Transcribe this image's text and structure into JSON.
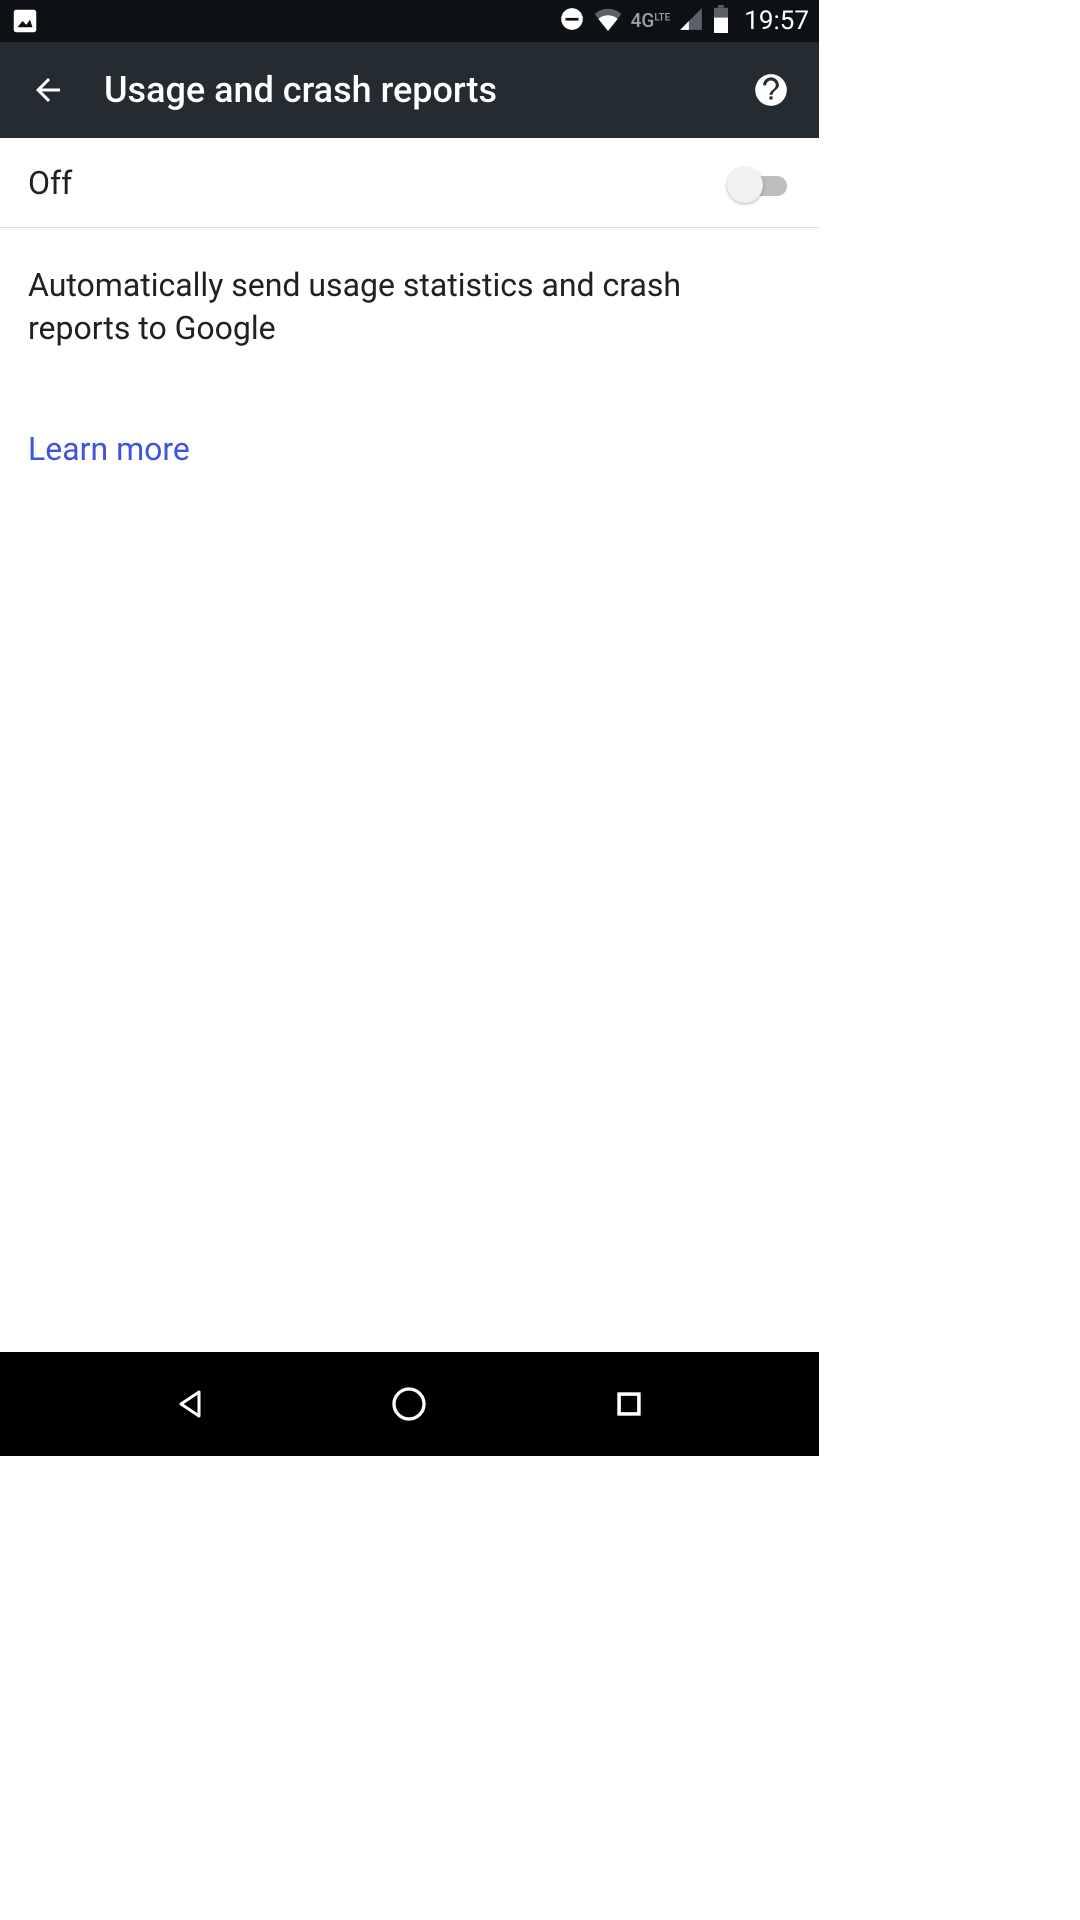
{
  "status_bar": {
    "network_label": "4G",
    "network_sub": "LTE",
    "time": "19:57"
  },
  "app_bar": {
    "title": "Usage and crash reports"
  },
  "toggle": {
    "state_label": "Off"
  },
  "content": {
    "description": "Automatically send usage statistics and crash reports to Google",
    "learn_more": "Learn more"
  }
}
